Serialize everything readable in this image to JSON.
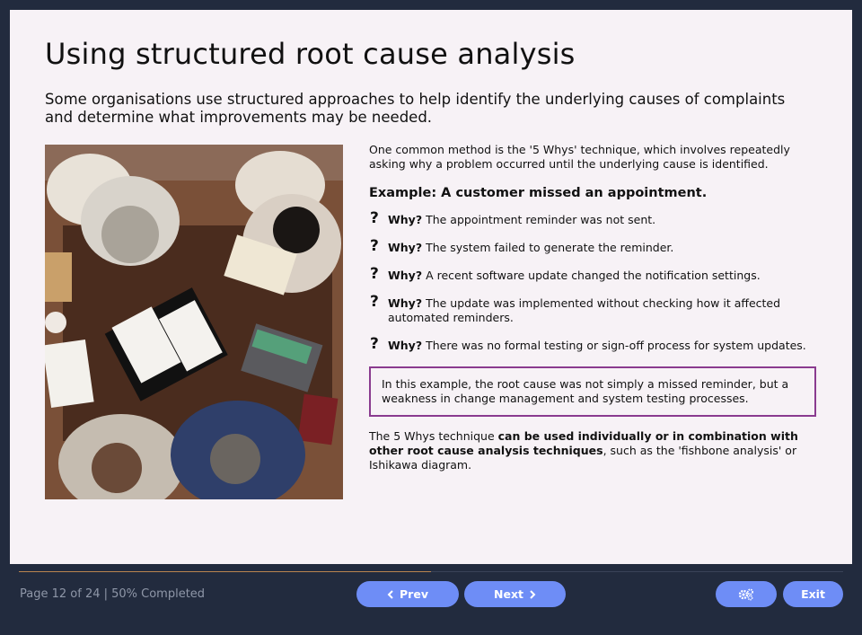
{
  "slide": {
    "title": "Using structured root cause analysis",
    "intro": "Some organisations use structured approaches to help identify the underlying causes of complaints and determine what improvements may be needed.",
    "method": "One common method is the '5 Whys' technique, which involves repeatedly asking why a problem occurred until the underlying cause is identified.",
    "example_heading": "Example: A customer missed an appointment.",
    "why_label": "Why?",
    "question_glyph": "?",
    "whys": [
      "The appointment reminder was not sent.",
      "The system failed to generate the reminder.",
      "A recent software update changed the notification settings.",
      "The update was implemented without checking how it affected automated reminders.",
      "There was no formal testing or sign-off process for system updates."
    ],
    "callout": "In this example, the root cause was not simply a missed reminder, but a weakness in change management and system testing processes.",
    "outro": {
      "part1": "The 5 Whys technique ",
      "bold": "can be used individually or in combination with other root cause analysis techniques",
      "part2": ", such as the 'fishbone analysis' or Ishikawa diagram."
    },
    "image_icon": "team-meeting-photo"
  },
  "footer": {
    "status": "Page 12 of 24 | 50% Completed",
    "progress_percent": 50,
    "prev_label": "Prev",
    "next_label": "Next",
    "exit_label": "Exit",
    "prev_icon": "chevron-left-icon",
    "next_icon": "chevron-right-icon",
    "settings_icon": "gear-icon"
  },
  "colors": {
    "button": "#6e8df6",
    "callout_border": "#8a3b8f",
    "progress": "#b9844f",
    "background": "#222b3e",
    "slide": "#f7f2f6"
  }
}
